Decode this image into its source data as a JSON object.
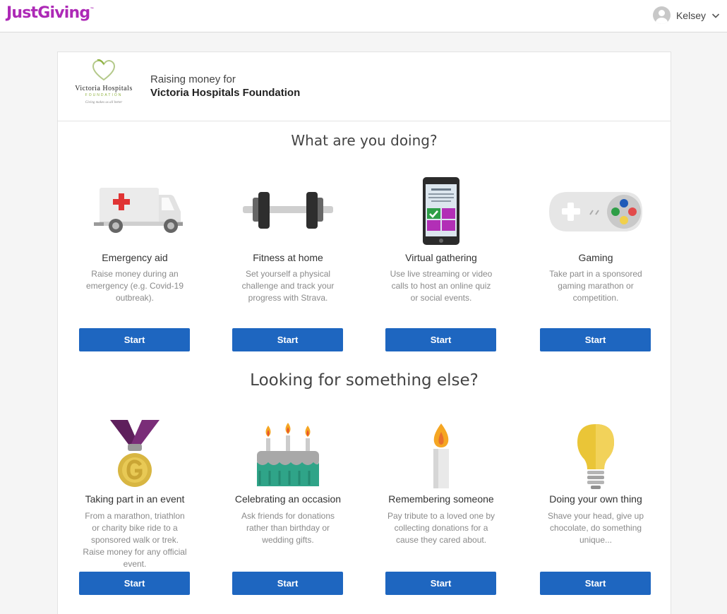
{
  "header": {
    "logo_text": "JustGiving",
    "logo_tm": "™",
    "user_name": "Kelsey"
  },
  "charity": {
    "logo_name": "Victoria Hospitals",
    "logo_subtitle": "FOUNDATION",
    "logo_tagline": "Giving makes us all better",
    "raising_label": "Raising money for",
    "name": "Victoria Hospitals Foundation"
  },
  "section1": {
    "heading": "What are you doing?",
    "options": [
      {
        "title": "Emergency aid",
        "description": "Raise money during an emergency (e.g. Covid-19 outbreak).",
        "button": "Start",
        "icon": "ambulance-icon"
      },
      {
        "title": "Fitness at home",
        "description": "Set yourself a physical challenge and track your progress with Strava.",
        "button": "Start",
        "icon": "dumbbell-icon"
      },
      {
        "title": "Virtual gathering",
        "description": "Use live streaming or video calls to host an online quiz or social events.",
        "button": "Start",
        "icon": "phone-icon"
      },
      {
        "title": "Gaming",
        "description": "Take part in a sponsored gaming marathon or competition.",
        "button": "Start",
        "icon": "game-controller-icon"
      }
    ]
  },
  "section2": {
    "heading": "Looking for something else?",
    "options": [
      {
        "title": "Taking part in an event",
        "description": "From a marathon, triathlon or charity bike ride to a sponsored walk or trek. Raise money for any official event.",
        "button": "Start",
        "icon": "medal-icon"
      },
      {
        "title": "Celebrating an occasion",
        "description": "Ask friends for donations rather than birthday or wedding gifts.",
        "button": "Start",
        "icon": "birthday-cake-icon"
      },
      {
        "title": "Remembering someone",
        "description": "Pay tribute to a loved one by collecting donations for a cause they cared about.",
        "button": "Start",
        "icon": "candle-icon"
      },
      {
        "title": "Doing your own thing",
        "description": "Shave your head, give up chocolate, do something unique...",
        "button": "Start",
        "icon": "lightbulb-icon"
      }
    ]
  },
  "colors": {
    "brand": "#ad29b6",
    "button": "#1e66c0",
    "page_bg": "#f5f5f5"
  }
}
